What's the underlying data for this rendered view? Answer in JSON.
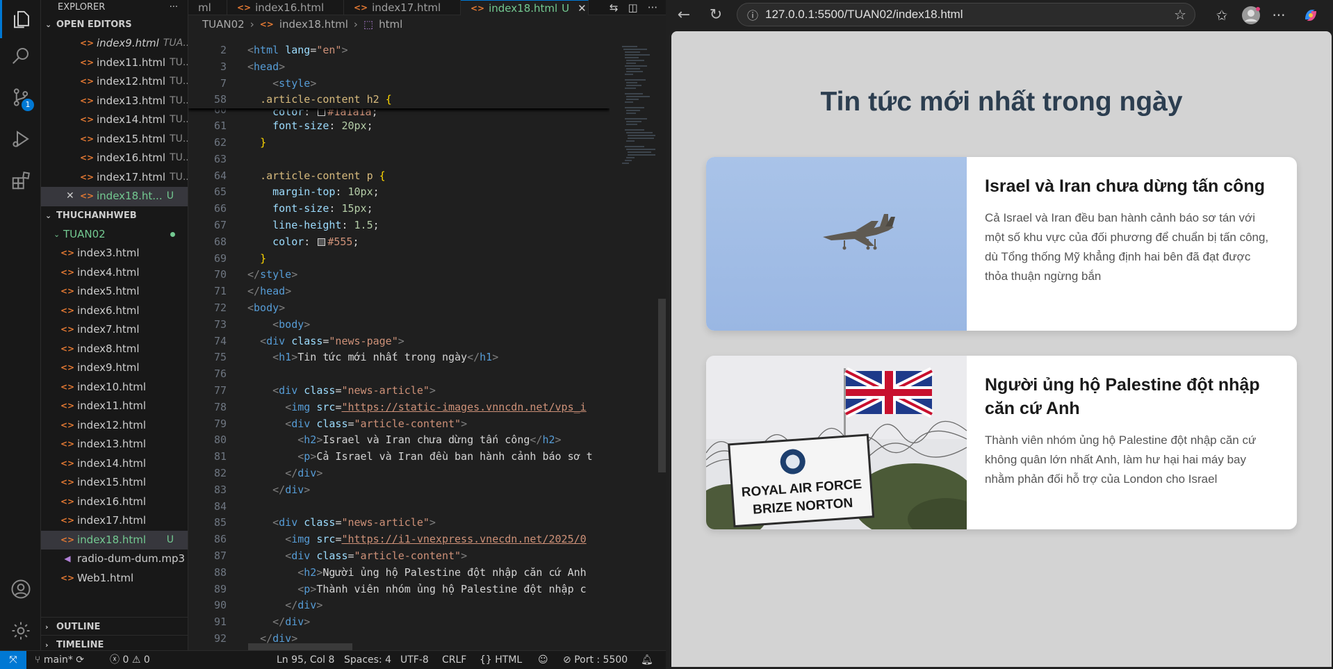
{
  "colors": {
    "accent": "#0078d4",
    "git_untracked": "#73c991",
    "html_file_icon": "#e37933",
    "news_title": "#2c3e50",
    "page_bg": "#d3d3d3"
  },
  "activity_bar": {
    "icons": [
      "files-icon",
      "search-icon",
      "source-control-icon",
      "run-debug-icon",
      "extensions-icon",
      "account-icon",
      "settings-gear-icon"
    ],
    "source_control_badge": "1"
  },
  "sidebar": {
    "title": "EXPLORER",
    "more": "···",
    "open_editors_label": "OPEN EDITORS",
    "open_editors": [
      {
        "name": "index9.html",
        "path": "TUA...",
        "italic": true
      },
      {
        "name": "index11.html",
        "path": "TU..."
      },
      {
        "name": "index12.html",
        "path": "TU..."
      },
      {
        "name": "index13.html",
        "path": "TU..."
      },
      {
        "name": "index14.html",
        "path": "TU..."
      },
      {
        "name": "index15.html",
        "path": "TU..."
      },
      {
        "name": "index16.html",
        "path": "TU..."
      },
      {
        "name": "index17.html",
        "path": "TU..."
      },
      {
        "name": "index18.ht...",
        "path": "",
        "status": "U"
      }
    ],
    "workspace_label": "THUCHANHWEB",
    "folder_label": "TUAN02",
    "files": [
      {
        "name": "index3.html"
      },
      {
        "name": "index4.html"
      },
      {
        "name": "index5.html"
      },
      {
        "name": "index6.html"
      },
      {
        "name": "index7.html"
      },
      {
        "name": "index8.html"
      },
      {
        "name": "index9.html"
      },
      {
        "name": "index10.html"
      },
      {
        "name": "index11.html"
      },
      {
        "name": "index12.html"
      },
      {
        "name": "index13.html"
      },
      {
        "name": "index14.html"
      },
      {
        "name": "index15.html"
      },
      {
        "name": "index16.html"
      },
      {
        "name": "index17.html"
      },
      {
        "name": "index18.html",
        "status": "U"
      },
      {
        "name": "radio-dum-dum.mp3",
        "kind": "audio"
      },
      {
        "name": "Web1.html"
      }
    ],
    "outline_label": "OUTLINE",
    "timeline_label": "TIMELINE"
  },
  "tabs": [
    {
      "label": "ml",
      "partial": true
    },
    {
      "label": "index16.html"
    },
    {
      "label": "index17.html"
    },
    {
      "label": "index18.html",
      "status": "U",
      "active": true
    }
  ],
  "breadcrumb": [
    "TUAN02",
    "index18.html",
    "html"
  ],
  "code": {
    "sticky": [
      {
        "n": "2",
        "html": "<span class='t-br'>&lt;</span><span class='t-tag'>html</span> <span class='t-attr'>lang</span><span class='t-txt'>=</span><span class='t-str'>\"en\"</span><span class='t-br'>&gt;</span>"
      },
      {
        "n": "3",
        "html": "<span class='t-br'>&lt;</span><span class='t-tag'>head</span><span class='t-br'>&gt;</span>"
      },
      {
        "n": "7",
        "html": "    <span class='t-br'>&lt;</span><span class='t-tag'>style</span><span class='t-br'>&gt;</span>"
      },
      {
        "n": "58",
        "html": "  <span class='t-sel'>.article-content h2</span> <span class='t-brace'>{</span>"
      }
    ],
    "lines": [
      {
        "n": "60",
        "html": "    <span class='t-prop'>color</span><span class='t-txt'>: </span><span class='swatch' style='background:#1a1a1a'></span><span class='t-str'>#1a1a1a</span><span class='t-txt'>;</span>",
        "clip": true
      },
      {
        "n": "61",
        "html": "    <span class='t-prop'>font-size</span><span class='t-txt'>: </span><span class='t-num'>20px</span><span class='t-txt'>;</span>"
      },
      {
        "n": "62",
        "html": "  <span class='t-brace'>}</span>"
      },
      {
        "n": "63",
        "html": ""
      },
      {
        "n": "64",
        "html": "  <span class='t-sel'>.article-content p</span> <span class='t-brace'>{</span>"
      },
      {
        "n": "65",
        "html": "    <span class='t-prop'>margin-top</span><span class='t-txt'>: </span><span class='t-num'>10px</span><span class='t-txt'>;</span>"
      },
      {
        "n": "66",
        "html": "    <span class='t-prop'>font-size</span><span class='t-txt'>: </span><span class='t-num'>15px</span><span class='t-txt'>;</span>"
      },
      {
        "n": "67",
        "html": "    <span class='t-prop'>line-height</span><span class='t-txt'>: </span><span class='t-num'>1.5</span><span class='t-txt'>;</span>"
      },
      {
        "n": "68",
        "html": "    <span class='t-prop'>color</span><span class='t-txt'>: </span><span class='swatch' style='background:#555'></span><span class='t-str'>#555</span><span class='t-txt'>;</span>"
      },
      {
        "n": "69",
        "html": "  <span class='t-brace'>}</span>"
      },
      {
        "n": "70",
        "html": "<span class='t-br'>&lt;/</span><span class='t-tag'>style</span><span class='t-br'>&gt;</span>"
      },
      {
        "n": "71",
        "html": "<span class='t-br'>&lt;/</span><span class='t-tag'>head</span><span class='t-br'>&gt;</span>"
      },
      {
        "n": "72",
        "html": "<span class='t-br'>&lt;</span><span class='t-tag'>body</span><span class='t-br'>&gt;</span>"
      },
      {
        "n": "73",
        "html": "    <span class='t-br'>&lt;</span><span class='t-tag'>body</span><span class='t-br'>&gt;</span>"
      },
      {
        "n": "74",
        "html": "  <span class='t-br'>&lt;</span><span class='t-tag'>div</span> <span class='t-attr'>class</span><span class='t-txt'>=</span><span class='t-str'>\"news-page\"</span><span class='t-br'>&gt;</span>"
      },
      {
        "n": "75",
        "html": "    <span class='t-br'>&lt;</span><span class='t-tag'>h1</span><span class='t-br'>&gt;</span><span class='t-txt'>Tin tức mới nhất trong ngày</span><span class='t-br'>&lt;/</span><span class='t-tag'>h1</span><span class='t-br'>&gt;</span>"
      },
      {
        "n": "76",
        "html": ""
      },
      {
        "n": "77",
        "html": "    <span class='t-br'>&lt;</span><span class='t-tag'>div</span> <span class='t-attr'>class</span><span class='t-txt'>=</span><span class='t-str'>\"news-article\"</span><span class='t-br'>&gt;</span>"
      },
      {
        "n": "78",
        "html": "      <span class='t-br'>&lt;</span><span class='t-tag'>img</span> <span class='t-attr'>src</span><span class='t-txt'>=</span><span class='t-link'>\"https://static-images.vnncdn.net/vps_i</span>"
      },
      {
        "n": "79",
        "html": "      <span class='t-br'>&lt;</span><span class='t-tag'>div</span> <span class='t-attr'>class</span><span class='t-txt'>=</span><span class='t-str'>\"article-content\"</span><span class='t-br'>&gt;</span>"
      },
      {
        "n": "80",
        "html": "        <span class='t-br'>&lt;</span><span class='t-tag'>h2</span><span class='t-br'>&gt;</span><span class='t-txt'>Israel và Iran chưa dừng tấn công</span><span class='t-br'>&lt;/</span><span class='t-tag'>h2</span><span class='t-br'>&gt;</span>"
      },
      {
        "n": "81",
        "html": "        <span class='t-br'>&lt;</span><span class='t-tag'>p</span><span class='t-br'>&gt;</span><span class='t-txt'>Cả Israel và Iran đều ban hành cảnh báo sơ t</span>"
      },
      {
        "n": "82",
        "html": "      <span class='t-br'>&lt;/</span><span class='t-tag'>div</span><span class='t-br'>&gt;</span>"
      },
      {
        "n": "83",
        "html": "    <span class='t-br'>&lt;/</span><span class='t-tag'>div</span><span class='t-br'>&gt;</span>"
      },
      {
        "n": "84",
        "html": ""
      },
      {
        "n": "85",
        "html": "    <span class='t-br'>&lt;</span><span class='t-tag'>div</span> <span class='t-attr'>class</span><span class='t-txt'>=</span><span class='t-str'>\"news-article\"</span><span class='t-br'>&gt;</span>"
      },
      {
        "n": "86",
        "html": "      <span class='t-br'>&lt;</span><span class='t-tag'>img</span> <span class='t-attr'>src</span><span class='t-txt'>=</span><span class='t-link'>\"https://i1-vnexpress.vnecdn.net/2025/0</span>"
      },
      {
        "n": "87",
        "html": "      <span class='t-br'>&lt;</span><span class='t-tag'>div</span> <span class='t-attr'>class</span><span class='t-txt'>=</span><span class='t-str'>\"article-content\"</span><span class='t-br'>&gt;</span>"
      },
      {
        "n": "88",
        "html": "        <span class='t-br'>&lt;</span><span class='t-tag'>h2</span><span class='t-br'>&gt;</span><span class='t-txt'>Người ủng hộ Palestine đột nhập căn cứ Anh</span>"
      },
      {
        "n": "89",
        "html": "        <span class='t-br'>&lt;</span><span class='t-tag'>p</span><span class='t-br'>&gt;</span><span class='t-txt'>Thành viên nhóm ủng hộ Palestine đột nhập c</span>"
      },
      {
        "n": "90",
        "html": "      <span class='t-br'>&lt;/</span><span class='t-tag'>div</span><span class='t-br'>&gt;</span>"
      },
      {
        "n": "91",
        "html": "    <span class='t-br'>&lt;/</span><span class='t-tag'>div</span><span class='t-br'>&gt;</span>"
      },
      {
        "n": "92",
        "html": "  <span class='t-br'>&lt;/</span><span class='t-tag'>div</span><span class='t-br'>&gt;</span>"
      }
    ]
  },
  "statusbar": {
    "branch": "main*",
    "problems": "0",
    "warnings": "0",
    "cursor": "Ln 95, Col 8",
    "spaces": "Spaces: 4",
    "encoding": "UTF-8",
    "eol": "CRLF",
    "language": "HTML",
    "port": "Port : 5500"
  },
  "browser": {
    "url": "127.0.0.1:5500/TUAN02/index18.html",
    "page_title": "Tin tức mới nhất trong ngày",
    "articles": [
      {
        "title": "Israel và Iran chưa dừng tấn công",
        "summary": "Cả Israel và Iran đều ban hành cảnh báo sơ tán với một số khu vực của đối phương để chuẩn bị tấn công, dù Tổng thống Mỹ khẳng định hai bên đã đạt được thỏa thuận ngừng bắn",
        "image": "fighter-jet-photo"
      },
      {
        "title": "Người ủng hộ Palestine đột nhập căn cứ Anh",
        "summary": "Thành viên nhóm ủng hộ Palestine đột nhập căn cứ không quân lớn nhất Anh, làm hư hại hai máy bay nhằm phản đối hỗ trợ của London cho Israel",
        "image": "raf-base-sign-photo",
        "sign_line1": "ROYAL AIR FORCE",
        "sign_line2": "BRIZE NORTON"
      }
    ]
  }
}
